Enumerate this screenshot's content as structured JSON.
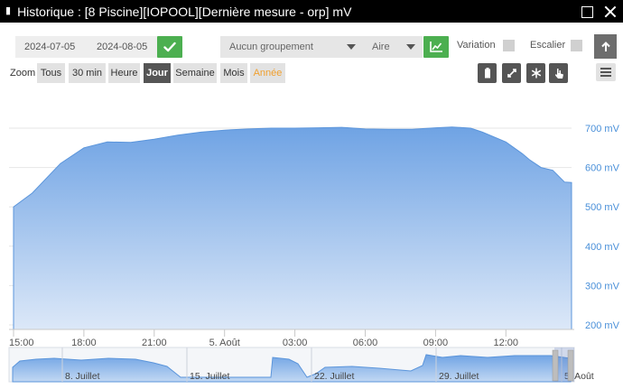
{
  "window": {
    "title": "Historique : [8 Piscine][IOPOOL][Dernière mesure - orp] mV",
    "icon": "chart-line-icon"
  },
  "toolbar": {
    "date_start": "2024-07-05",
    "date_end": "2024-08-05",
    "grouping": "Aucun groupement",
    "chart_type": "Aire",
    "variation_label": "Variation",
    "staircase_label": "Escalier"
  },
  "zoom": {
    "label": "Zoom",
    "buttons": [
      "Tous",
      "30 min",
      "Heure",
      "Jour",
      "Semaine",
      "Mois",
      "Année"
    ],
    "active": "Jour",
    "disabled": "Année"
  },
  "colors": {
    "accent": "#4caf50",
    "area_top": "#6fa3e4",
    "area_bottom": "#dce8f8",
    "axis_label": "#4a90d9"
  },
  "chart_data": {
    "type": "area",
    "y_unit": "mV",
    "ylim": [
      200,
      700
    ],
    "y_ticks": [
      "700 mV",
      "600 mV",
      "500 mV",
      "400 mV",
      "300 mV",
      "200 mV"
    ],
    "y_tick_values": [
      700,
      600,
      500,
      400,
      300,
      200
    ],
    "x_ticks": [
      "15:00",
      "18:00",
      "21:00",
      "5. Août",
      "03:00",
      "06:00",
      "09:00",
      "12:00"
    ],
    "x_tick_hours": [
      0,
      3,
      6,
      9,
      12,
      15,
      18,
      21
    ],
    "x_range_hours": [
      0,
      23.8
    ],
    "series": [
      {
        "x_hours": [
          0,
          0.8,
          2.0,
          3.0,
          4.0,
          5.0,
          6.0,
          7.0,
          8.0,
          9.0,
          10.0,
          11.0,
          12.0,
          13.0,
          14.0,
          15.0,
          16.0,
          17.0,
          18.0,
          18.7,
          19.5,
          20.0,
          21.0,
          21.7,
          22.0,
          22.5,
          23.0,
          23.5,
          23.8
        ],
        "values": [
          500,
          535,
          610,
          650,
          665,
          664,
          672,
          682,
          690,
          695,
          698,
          700,
          700,
          701,
          702,
          698,
          697,
          697,
          701,
          703,
          700,
          690,
          665,
          635,
          620,
          600,
          593,
          563,
          562
        ]
      }
    ],
    "grid": true
  },
  "navigator": {
    "labels": [
      "8. Juillet",
      "15. Juillet",
      "22. Juillet",
      "29. Juillet",
      "5. Août"
    ]
  }
}
